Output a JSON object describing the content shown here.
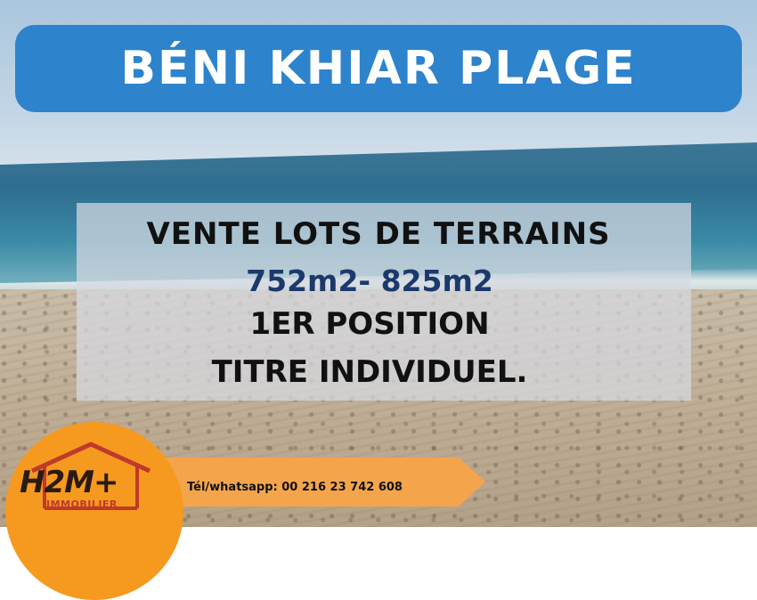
{
  "title": "BÉNI KHIAR PLAGE",
  "info": {
    "line1": "VENTE LOTS DE TERRAINS",
    "line2": "752m2- 825m2",
    "line3": "1ER POSITION",
    "line4": "TITRE INDIVIDUEL."
  },
  "contact": {
    "phone": "Tél/whatsapp: 00 216 23 742 608"
  },
  "logo": {
    "name": "H2M+",
    "subtitle": "IMMOBILIER"
  },
  "colors": {
    "title_bg": "#2d83cc",
    "price_text": "#1b3a6b",
    "logo_bg": "#f59a1f",
    "banner_bg": "#f4a54c"
  }
}
